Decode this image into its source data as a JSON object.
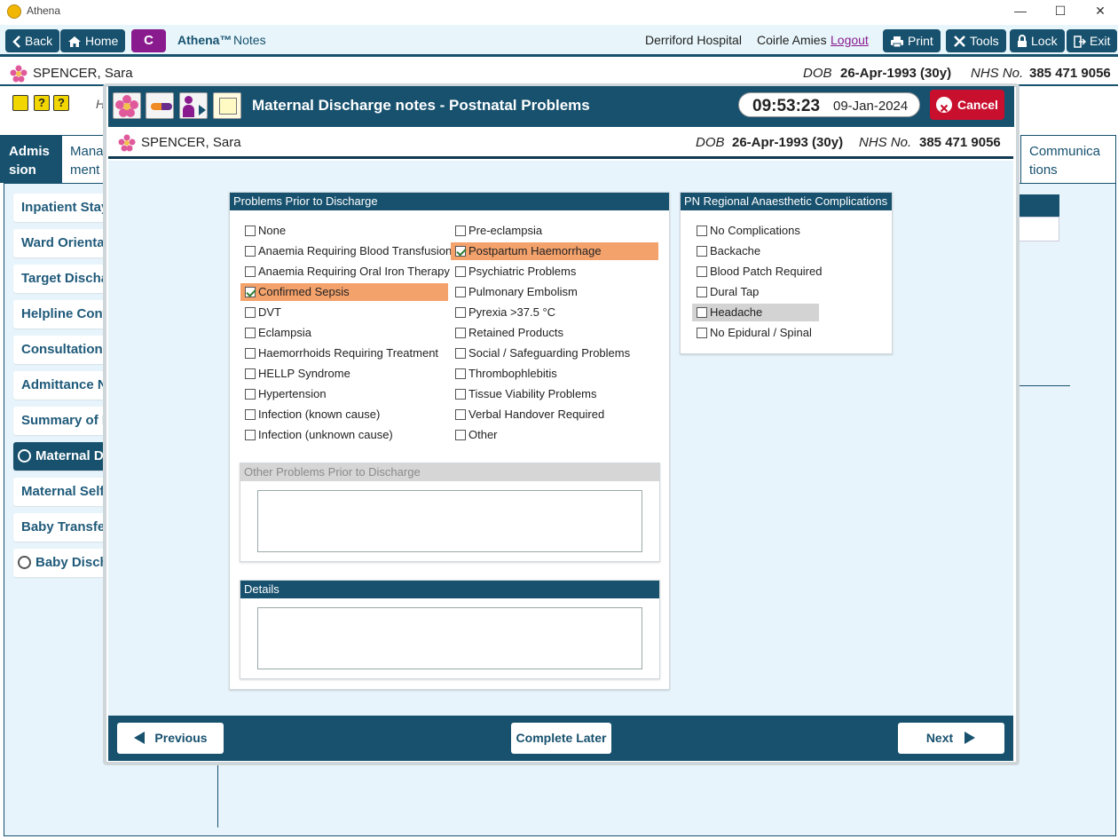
{
  "window": {
    "app_name": "Athena",
    "minimize": "—",
    "maximize": "☐",
    "close": "✕"
  },
  "toolbar": {
    "back": "Back",
    "home": "Home",
    "c_label": "C",
    "brand": "Athena™",
    "brand_suffix": "Notes",
    "hospital": "Derriford Hospital",
    "user": "Coirle Amies",
    "logout": "Logout",
    "print": "Print",
    "tools": "Tools",
    "lock": "Lock",
    "exit": "Exit"
  },
  "patient": {
    "name": "SPENCER, Sara",
    "dob_label": "DOB",
    "dob": "26-Apr-1993 (30y)",
    "nhs_label": "NHS No.",
    "nhs": "385 471 9056"
  },
  "background": {
    "tabs": [
      {
        "label": "Admis\nsion"
      },
      {
        "label": "Mana\nment"
      },
      {
        "label": "Communica\ntions"
      }
    ],
    "sidebar_items": [
      {
        "label": "Inpatient Stay"
      },
      {
        "label": "Ward Orientat"
      },
      {
        "label": "Target Dischar"
      },
      {
        "label": "Helpline Cont"
      },
      {
        "label": "Consultation I"
      },
      {
        "label": "Admittance N"
      },
      {
        "label": "Summary of P"
      },
      {
        "label": "Maternal Di"
      },
      {
        "label": "Maternal Self"
      },
      {
        "label": "Baby Transfer"
      },
      {
        "label": "Baby Discha"
      }
    ],
    "partial_letter": "H"
  },
  "modal": {
    "title": "Maternal Discharge notes - Postnatal Problems",
    "time": "09:53:23",
    "date": "09-Jan-2024",
    "cancel": "Cancel",
    "problems_panel": {
      "title": "Problems Prior to Discharge",
      "col1": [
        {
          "label": "None",
          "checked": false
        },
        {
          "label": "Anaemia Requiring Blood Transfusion",
          "checked": false
        },
        {
          "label": "Anaemia Requiring Oral Iron Therapy",
          "checked": false
        },
        {
          "label": "Confirmed Sepsis",
          "checked": true
        },
        {
          "label": "DVT",
          "checked": false
        },
        {
          "label": "Eclampsia",
          "checked": false
        },
        {
          "label": "Haemorrhoids Requiring Treatment",
          "checked": false
        },
        {
          "label": "HELLP Syndrome",
          "checked": false
        },
        {
          "label": "Hypertension",
          "checked": false
        },
        {
          "label": "Infection (known cause)",
          "checked": false
        },
        {
          "label": "Infection (unknown cause)",
          "checked": false
        }
      ],
      "col2": [
        {
          "label": "Pre-eclampsia",
          "checked": false
        },
        {
          "label": "Postpartum Haemorrhage",
          "checked": true
        },
        {
          "label": "Psychiatric Problems",
          "checked": false
        },
        {
          "label": "Pulmonary Embolism",
          "checked": false
        },
        {
          "label": "Pyrexia >37.5 °C",
          "checked": false
        },
        {
          "label": "Retained Products",
          "checked": false
        },
        {
          "label": "Social / Safeguarding Problems",
          "checked": false
        },
        {
          "label": "Thrombophlebitis",
          "checked": false
        },
        {
          "label": "Tissue Viability Problems",
          "checked": false
        },
        {
          "label": "Verbal Handover Required",
          "checked": false
        },
        {
          "label": "Other",
          "checked": false
        }
      ],
      "other_title": "Other Problems Prior to Discharge",
      "other_value": "",
      "details_title": "Details",
      "details_value": ""
    },
    "anaesthetic_panel": {
      "title": "PN Regional Anaesthetic Complications",
      "items": [
        {
          "label": "No Complications",
          "checked": false
        },
        {
          "label": "Backache",
          "checked": false
        },
        {
          "label": "Blood Patch Required",
          "checked": false
        },
        {
          "label": "Dural Tap",
          "checked": false
        },
        {
          "label": "Headache",
          "checked": false
        },
        {
          "label": "No Epidural / Spinal",
          "checked": false
        }
      ]
    },
    "footer": {
      "previous": "Previous",
      "complete_later": "Complete Later",
      "next": "Next"
    }
  },
  "colors": {
    "primary": "#17516e",
    "highlight": "#f4a26c",
    "cancel": "#c8102e",
    "panel_bg": "#e8f4fb"
  }
}
